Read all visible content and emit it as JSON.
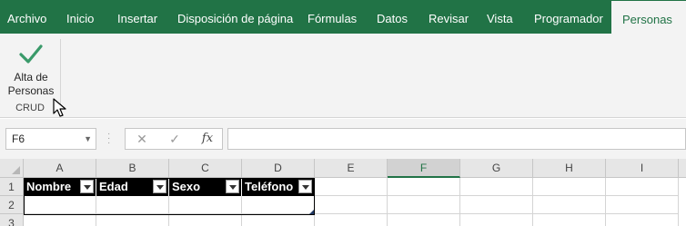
{
  "ribbon_tabs": [
    "Archivo",
    "Inicio",
    "Insertar",
    "Disposición de página",
    "Fórmulas",
    "Datos",
    "Revisar",
    "Vista",
    "Programador",
    "Personas"
  ],
  "active_tab": "Personas",
  "ribbon": {
    "button_line1": "Alta de",
    "button_line2": "Personas",
    "group_label": "CRUD",
    "icon": "checkmark-icon"
  },
  "formula_bar": {
    "name_box": "F6",
    "cancel_symbol": "✕",
    "enter_symbol": "✓",
    "fx_label": "fx",
    "formula": ""
  },
  "columns": [
    "A",
    "B",
    "C",
    "D",
    "E",
    "F",
    "G",
    "H",
    "I"
  ],
  "selected_column": "F",
  "rows": [
    "1",
    "2",
    "3"
  ],
  "table": {
    "headers": [
      "Nombre",
      "Edad",
      "Sexo",
      "Teléfono"
    ]
  },
  "colors": {
    "ribbon_green": "#217346",
    "table_header_bg": "#000000",
    "table_header_text": "#ffffff"
  }
}
